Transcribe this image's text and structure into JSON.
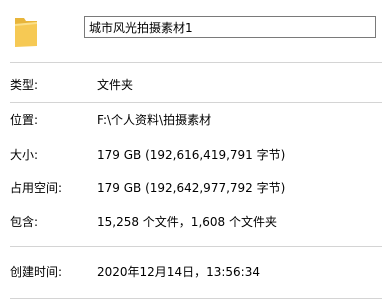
{
  "folder": {
    "name": "城市风光拍摄素材1",
    "icon": "folder-icon"
  },
  "properties": {
    "type": {
      "label": "类型:",
      "value": "文件夹"
    },
    "location": {
      "label": "位置:",
      "value": "F:\\个人资料\\拍摄素材"
    },
    "size": {
      "label": "大小:",
      "value": "179 GB (192,616,419,791 字节)"
    },
    "size_on_disk": {
      "label": "占用空间:",
      "value": "179 GB (192,642,977,792 字节)"
    },
    "contains": {
      "label": "包含:",
      "value": "15,258 个文件，1,608 个文件夹"
    },
    "created": {
      "label": "创建时间:",
      "value": "2020年12月14日，13:56:34"
    }
  },
  "colors": {
    "folder_body": "#f6c954",
    "folder_back": "#e8b53a",
    "divider": "#d4d4d4",
    "input_border": "#7a7a7a"
  }
}
